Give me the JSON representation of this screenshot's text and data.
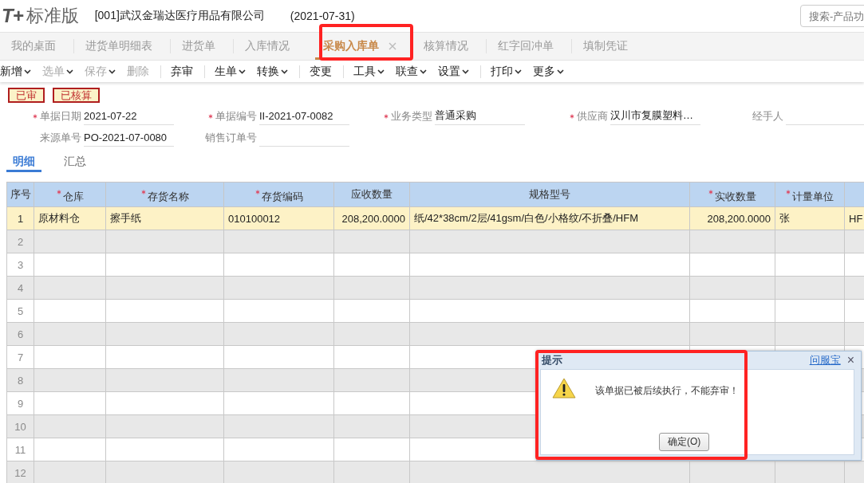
{
  "header": {
    "logo_mark": "T+",
    "product": "标准版",
    "company": "[001]武汉金瑞达医疗用品有限公司",
    "date": "(2021-07-31)",
    "search": {
      "placeholder": "搜索-产品功"
    }
  },
  "tabs": [
    {
      "label": "我的桌面",
      "selected": false,
      "closable": false
    },
    {
      "label": "进货单明细表",
      "selected": false,
      "closable": false
    },
    {
      "label": "进货单",
      "selected": false,
      "closable": false
    },
    {
      "label": "入库情况",
      "selected": false,
      "closable": false
    },
    {
      "label": "采购入库单",
      "selected": true,
      "closable": true
    },
    {
      "label": "核算情况",
      "selected": false,
      "closable": false
    },
    {
      "label": "红字回冲单",
      "selected": false,
      "closable": false
    },
    {
      "label": "填制凭证",
      "selected": false,
      "closable": false
    }
  ],
  "toolbar": [
    {
      "label": "新增",
      "dropdown": true,
      "disabled": false,
      "divider": false
    },
    {
      "label": "选单",
      "dropdown": true,
      "disabled": true,
      "divider": false
    },
    {
      "label": "保存",
      "dropdown": true,
      "disabled": true,
      "divider": false
    },
    {
      "label": "删除",
      "dropdown": false,
      "disabled": true,
      "divider": true
    },
    {
      "label": "弃审",
      "dropdown": false,
      "disabled": false,
      "divider": true
    },
    {
      "label": "生单",
      "dropdown": true,
      "disabled": false,
      "divider": false
    },
    {
      "label": "转换",
      "dropdown": true,
      "disabled": false,
      "divider": true
    },
    {
      "label": "变更",
      "dropdown": false,
      "disabled": false,
      "divider": true
    },
    {
      "label": "工具",
      "dropdown": true,
      "disabled": false,
      "divider": false
    },
    {
      "label": "联查",
      "dropdown": true,
      "disabled": false,
      "divider": false
    },
    {
      "label": "设置",
      "dropdown": true,
      "disabled": false,
      "divider": true
    },
    {
      "label": "打印",
      "dropdown": true,
      "disabled": false,
      "divider": false
    },
    {
      "label": "更多",
      "dropdown": true,
      "disabled": false,
      "divider": false
    }
  ],
  "status_badges": [
    "已审",
    "已核算"
  ],
  "form": {
    "rows": [
      [
        {
          "label": "单据日期",
          "required": true,
          "value": "2021-07-22"
        },
        {
          "label": "单据编号",
          "required": true,
          "value": "II-2021-07-0082"
        },
        {
          "label": "业务类型",
          "required": true,
          "value": "普通采购"
        },
        {
          "label": "供应商",
          "required": true,
          "value": "汉川市复膜塑料…"
        },
        {
          "label": "经手人",
          "required": false
        }
      ],
      [
        {
          "label": "来源单号",
          "required": false,
          "value": "PO-2021-07-0080"
        },
        {
          "label": "销售订单号",
          "required": false
        }
      ]
    ]
  },
  "detail_tabs": [
    {
      "label": "明细",
      "selected": true
    },
    {
      "label": "汇总",
      "selected": false
    }
  ],
  "table": {
    "columns": [
      {
        "label": "序号",
        "required": false
      },
      {
        "label": "仓库",
        "required": true
      },
      {
        "label": "存货名称",
        "required": true
      },
      {
        "label": "存货编码",
        "required": true
      },
      {
        "label": "应收数量",
        "required": false
      },
      {
        "label": "规格型号",
        "required": false
      },
      {
        "label": "实收数量",
        "required": true
      },
      {
        "label": "计量单位",
        "required": true
      }
    ],
    "rows": [
      {
        "no": "1",
        "selected": true,
        "cells": [
          "原材料仓",
          "擦手纸",
          "010100012",
          "208,200.0000",
          "纸/42*38cm/2层/41gsm/白色/小格纹/不折叠/HFM",
          "208,200.0000",
          "张",
          "HF"
        ]
      },
      {
        "no": "2",
        "selected": false
      },
      {
        "no": "3",
        "selected": false
      },
      {
        "no": "4",
        "selected": false
      },
      {
        "no": "5",
        "selected": false
      },
      {
        "no": "6",
        "selected": false
      },
      {
        "no": "7",
        "selected": false
      },
      {
        "no": "8",
        "selected": false
      },
      {
        "no": "9",
        "selected": false
      },
      {
        "no": "10",
        "selected": false
      },
      {
        "no": "11",
        "selected": false
      },
      {
        "no": "12",
        "selected": false
      }
    ]
  },
  "dialog": {
    "title": "提示",
    "help_link": "问服宝",
    "close": "×",
    "message": "该单据已被后续执行，不能弃审！",
    "ok_button": "确定(O)"
  }
}
